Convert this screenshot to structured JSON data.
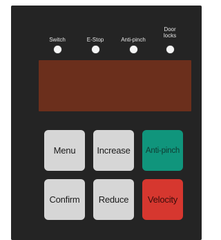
{
  "indicators": [
    {
      "label": "Switch",
      "color": "#f4f4f4"
    },
    {
      "label": "E-Stop",
      "color": "#f4f4f4"
    },
    {
      "label": "Anti-pinch",
      "color": "#f4f4f4"
    },
    {
      "label": "Door\nlocks",
      "color": "#f4f4f4"
    }
  ],
  "display": {
    "color": "#6b2f1c"
  },
  "buttons": {
    "menu": {
      "label": "Menu",
      "color": "#d6d6d6"
    },
    "increase": {
      "label": "Increase",
      "color": "#d6d6d6"
    },
    "anti_pinch": {
      "label": "Anti-pinch",
      "color": "#10957c"
    },
    "confirm": {
      "label": "Confirm",
      "color": "#d6d6d6"
    },
    "reduce": {
      "label": "Reduce",
      "color": "#d6d6d6"
    },
    "velocity": {
      "label": "Velocity",
      "color": "#d6372f"
    }
  },
  "panel_color": "#242424"
}
